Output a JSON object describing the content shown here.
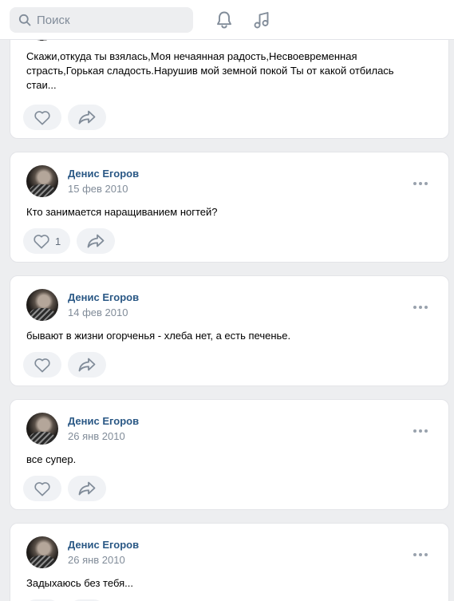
{
  "header": {
    "search_placeholder": "Поиск",
    "icons": [
      "search-icon",
      "bell-icon",
      "music-icon"
    ]
  },
  "posts": [
    {
      "text": "Скажи,откуда ты взялась,Моя нечаянная радость,Несвоевременная страсть,Горькая сладость.Нарушив мой земной покой Ты от какой отбилась стаи..."
    },
    {
      "author": "Денис Егоров",
      "date": "15 фев 2010",
      "text": "Кто занимается наращиванием ногтей?",
      "likes": "1"
    },
    {
      "author": "Денис Егоров",
      "date": "14 фев 2010",
      "text": "бывают в жизни огорченья - хлеба нет, а есть печенье."
    },
    {
      "author": "Денис Егоров",
      "date": "26 янв 2010",
      "text": "все супер."
    },
    {
      "author": "Денис Егоров",
      "date": "26 янв 2010",
      "text": "Задыхаюсь без тебя..."
    }
  ],
  "colors": {
    "background": "#edeef0",
    "card": "#ffffff",
    "author": "#2a5885",
    "muted": "#818c99",
    "icon": "#99a2ad",
    "button": "#f0f2f5"
  }
}
